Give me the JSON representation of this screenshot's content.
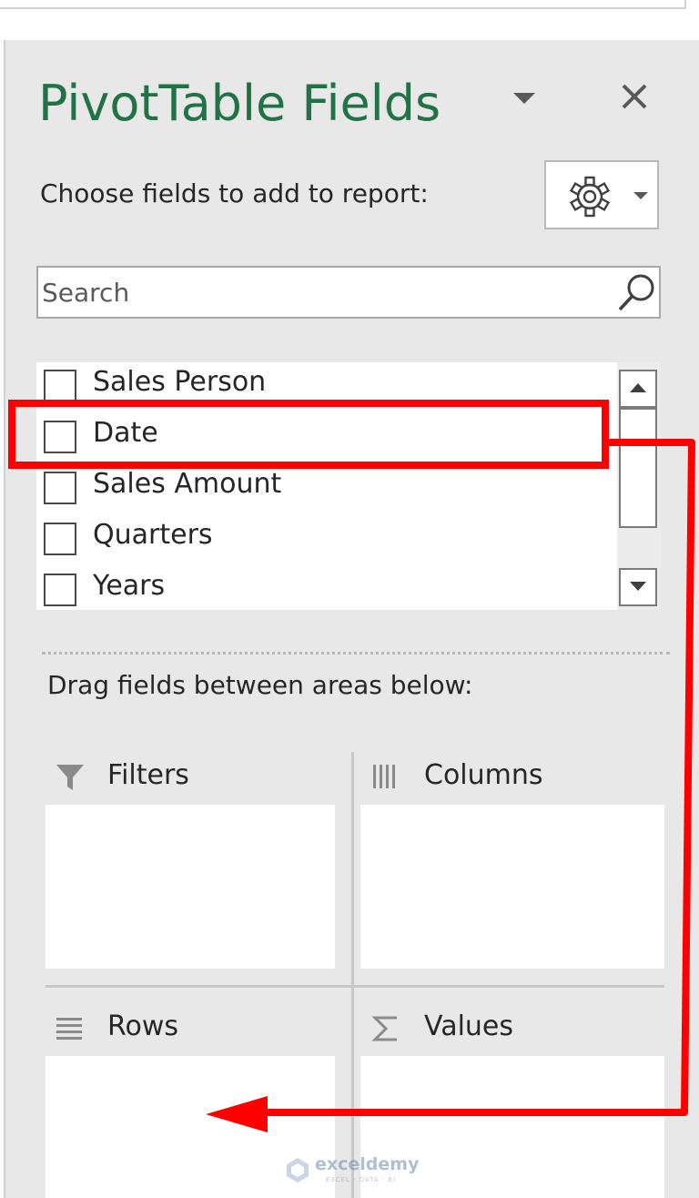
{
  "pane": {
    "title": "PivotTable Fields",
    "choose_label": "Choose fields to add to report:",
    "search": {
      "placeholder": "Search",
      "value": ""
    },
    "fields": [
      {
        "label": "Sales Person",
        "checked": false
      },
      {
        "label": "Date",
        "checked": false
      },
      {
        "label": "Sales Amount",
        "checked": false
      },
      {
        "label": "Quarters",
        "checked": false
      },
      {
        "label": "Years",
        "checked": false
      }
    ],
    "drag_label": "Drag fields between areas below:",
    "areas": {
      "filters": {
        "label": "Filters",
        "icon": "filter-icon"
      },
      "columns": {
        "label": "Columns",
        "icon": "columns-icon"
      },
      "rows": {
        "label": "Rows",
        "icon": "rows-icon"
      },
      "values": {
        "label": "Values",
        "icon": "sigma-icon"
      }
    }
  },
  "watermark": {
    "name": "exceldemy",
    "tagline": "EXCEL · DATA · BI"
  },
  "colors": {
    "title_green": "#217346",
    "pane_background": "#e8e8e8",
    "annotation_red": "#ff0000"
  }
}
